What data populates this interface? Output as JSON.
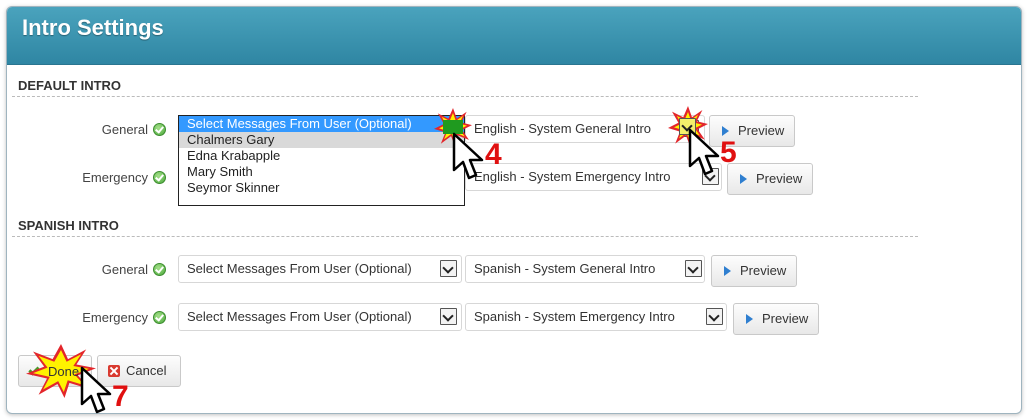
{
  "header": {
    "title": "Intro Settings"
  },
  "default_intro": {
    "section_title": "DEFAULT INTRO",
    "general": {
      "label": "General",
      "user_select": "Select Messages From User (Optional)",
      "intro_select": "English - System General Intro",
      "preview_label": "Preview"
    },
    "emergency": {
      "label": "Emergency",
      "intro_select": "English - System Emergency Intro",
      "preview_label": "Preview"
    }
  },
  "user_dropdown": {
    "options": [
      "Select Messages From User (Optional)",
      "Chalmers Gary",
      "Edna Krabapple",
      "Mary Smith",
      "Seymor Skinner"
    ]
  },
  "spanish_intro": {
    "section_title": "SPANISH INTRO",
    "general": {
      "label": "General",
      "user_select": "Select Messages From User (Optional)",
      "intro_select": "Spanish - System General Intro",
      "preview_label": "Preview"
    },
    "emergency": {
      "label": "Emergency",
      "user_select": "Select Messages From User (Optional)",
      "intro_select": "Spanish - System Emergency Intro",
      "preview_label": "Preview"
    }
  },
  "footer": {
    "done_label": "Done",
    "cancel_label": "Cancel"
  },
  "annotations": {
    "step_4": "4",
    "step_5": "5",
    "step_7": "7"
  },
  "colors": {
    "header": "#3596b3",
    "highlight": "#3399ff",
    "step_marker": "#e01010",
    "burst": "#fff200"
  }
}
